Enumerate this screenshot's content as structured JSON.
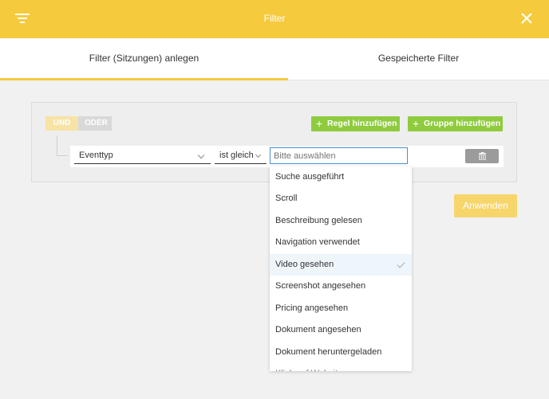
{
  "header": {
    "title": "Filter"
  },
  "tabs": [
    {
      "label": "Filter (Sitzungen) anlegen"
    },
    {
      "label": "Gespeicherte Filter"
    }
  ],
  "group": {
    "toggle_and": "UND",
    "toggle_or": "ODER",
    "add_rule": "Regel hinzufügen",
    "add_group": "Gruppe hinzufügen"
  },
  "rule": {
    "field": "Eventtyp",
    "operator": "ist gleich",
    "value_placeholder": "Bitte auswählen"
  },
  "apply_label": "Anwenden",
  "dropdown": {
    "options": [
      "Suche ausgeführt",
      "Scroll",
      "Beschreibung gelesen",
      "Navigation verwendet",
      "Video gesehen",
      "Screenshot angesehen",
      "Pricing angesehen",
      "Dokument angesehen",
      "Dokument heruntergeladen",
      "Klick auf Website"
    ],
    "selected": "Video gesehen"
  },
  "colors": {
    "accent": "#f6ca3d",
    "green": "#8fcb3e"
  }
}
